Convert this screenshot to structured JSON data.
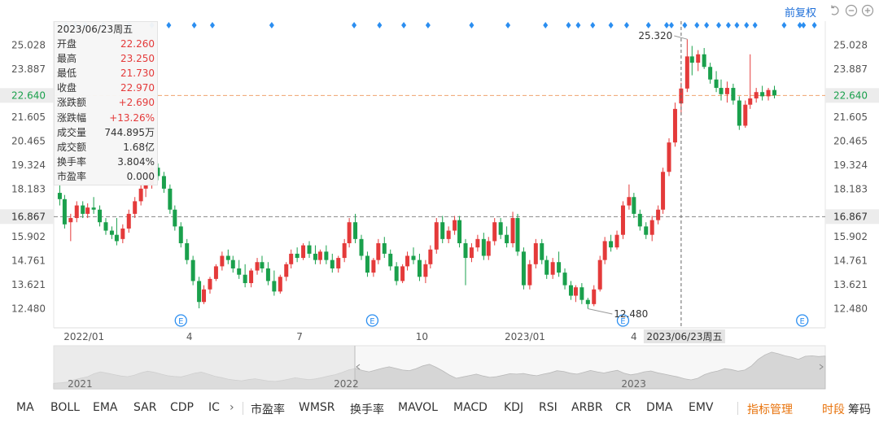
{
  "chart_data": {
    "type": "candlestick",
    "price_axis": {
      "ticks": [
        25.028,
        23.887,
        22.746,
        21.605,
        20.465,
        19.324,
        18.183,
        17.042,
        15.902,
        14.761,
        13.621,
        12.48
      ],
      "labels": [
        "25.028",
        "23.887",
        "",
        "21.605",
        "20.465",
        "19.324",
        "18.183",
        "",
        "15.902",
        "14.761",
        "13.621",
        "12.480"
      ],
      "range": [
        11.57,
        26.18
      ]
    },
    "x_labels": [
      {
        "text": "2022/01",
        "date": "2022-01-04"
      },
      {
        "text": "4",
        "date": "2022-04-01"
      },
      {
        "text": "7",
        "date": "2022-07-01"
      },
      {
        "text": "10",
        "date": "2022-10-10"
      },
      {
        "text": "2023/01",
        "date": "2023-01-03"
      },
      {
        "text": "4",
        "date": "2023-04-03"
      }
    ],
    "current_price": {
      "value": 22.64,
      "label": "22.640",
      "color": "#1aa04c"
    },
    "reference_line": {
      "value": 16.867,
      "label": "16.867"
    },
    "max_annotation": {
      "value": 25.32,
      "label": "25.320"
    },
    "min_annotation": {
      "value": 12.48,
      "label": "12.480"
    },
    "cursor_date_label": "2023/06/23周五",
    "up_color": "#e43a3a",
    "down_color": "#1aa04c",
    "ohlc": [
      [
        18.0,
        18.4,
        17.4,
        17.7
      ],
      [
        17.7,
        17.9,
        16.3,
        16.5
      ],
      [
        16.6,
        17.0,
        15.7,
        16.8
      ],
      [
        16.8,
        17.6,
        16.6,
        17.4
      ],
      [
        17.4,
        17.6,
        16.8,
        17.0
      ],
      [
        17.0,
        17.5,
        16.8,
        17.3
      ],
      [
        17.3,
        17.8,
        17.0,
        17.2
      ],
      [
        17.2,
        17.4,
        16.4,
        16.6
      ],
      [
        16.6,
        16.8,
        16.0,
        16.2
      ],
      [
        16.2,
        16.4,
        15.8,
        16.0
      ],
      [
        16.0,
        16.8,
        15.5,
        15.7
      ],
      [
        15.8,
        16.5,
        15.6,
        16.3
      ],
      [
        16.3,
        17.2,
        16.1,
        17.0
      ],
      [
        17.0,
        17.8,
        16.8,
        17.6
      ],
      [
        17.6,
        18.4,
        17.4,
        18.2
      ],
      [
        18.2,
        18.6,
        17.8,
        18.4
      ],
      [
        18.4,
        19.4,
        18.2,
        19.2
      ],
      [
        19.2,
        19.4,
        18.6,
        18.8
      ],
      [
        18.8,
        19.0,
        18.0,
        18.2
      ],
      [
        18.2,
        18.4,
        17.0,
        17.2
      ],
      [
        17.2,
        17.4,
        16.2,
        16.4
      ],
      [
        16.4,
        16.6,
        15.4,
        15.6
      ],
      [
        15.6,
        15.8,
        14.6,
        14.8
      ],
      [
        14.8,
        15.0,
        13.6,
        13.8
      ],
      [
        13.8,
        14.0,
        12.5,
        12.8
      ],
      [
        12.8,
        13.6,
        12.7,
        13.4
      ],
      [
        13.4,
        14.0,
        13.2,
        13.9
      ],
      [
        13.9,
        14.6,
        13.8,
        14.5
      ],
      [
        14.5,
        15.2,
        14.3,
        15.0
      ],
      [
        15.0,
        15.3,
        14.6,
        14.8
      ],
      [
        14.8,
        15.0,
        14.2,
        14.4
      ],
      [
        14.4,
        14.8,
        13.9,
        14.1
      ],
      [
        14.1,
        14.6,
        13.5,
        13.7
      ],
      [
        13.7,
        14.4,
        13.5,
        14.3
      ],
      [
        14.3,
        14.9,
        14.1,
        14.7
      ],
      [
        14.7,
        15.0,
        14.2,
        14.4
      ],
      [
        14.4,
        14.7,
        13.6,
        13.8
      ],
      [
        13.8,
        14.3,
        13.1,
        13.3
      ],
      [
        13.3,
        14.1,
        13.2,
        14.0
      ],
      [
        14.0,
        14.7,
        13.8,
        14.6
      ],
      [
        14.6,
        15.3,
        14.4,
        15.1
      ],
      [
        15.1,
        15.4,
        14.7,
        14.9
      ],
      [
        14.9,
        15.6,
        14.8,
        15.5
      ],
      [
        15.5,
        15.7,
        14.9,
        15.1
      ],
      [
        15.1,
        15.5,
        14.6,
        14.8
      ],
      [
        14.8,
        15.3,
        14.6,
        15.2
      ],
      [
        15.2,
        15.5,
        14.6,
        14.8
      ],
      [
        14.8,
        15.1,
        14.2,
        14.4
      ],
      [
        14.4,
        15.0,
        14.2,
        14.9
      ],
      [
        14.9,
        15.8,
        14.7,
        15.6
      ],
      [
        15.6,
        16.8,
        15.4,
        16.6
      ],
      [
        16.6,
        17.0,
        15.6,
        15.8
      ],
      [
        15.8,
        16.0,
        14.8,
        15.0
      ],
      [
        15.0,
        15.2,
        14.0,
        14.2
      ],
      [
        14.2,
        14.9,
        14.0,
        14.8
      ],
      [
        14.8,
        15.8,
        14.6,
        15.6
      ],
      [
        15.6,
        15.9,
        14.9,
        15.1
      ],
      [
        15.1,
        15.3,
        14.3,
        14.5
      ],
      [
        14.5,
        14.7,
        13.6,
        13.8
      ],
      [
        13.8,
        14.6,
        13.7,
        14.5
      ],
      [
        14.5,
        15.2,
        14.3,
        15.0
      ],
      [
        15.0,
        15.4,
        14.6,
        14.8
      ],
      [
        14.8,
        15.1,
        13.8,
        14.0
      ],
      [
        14.0,
        14.8,
        13.7,
        14.6
      ],
      [
        14.6,
        15.5,
        14.4,
        15.3
      ],
      [
        15.3,
        16.8,
        15.1,
        16.6
      ],
      [
        16.6,
        16.9,
        15.6,
        15.8
      ],
      [
        15.8,
        16.4,
        15.6,
        16.2
      ],
      [
        16.2,
        16.9,
        16.0,
        16.7
      ],
      [
        16.7,
        16.9,
        15.4,
        15.6
      ],
      [
        15.6,
        15.8,
        13.6,
        14.9
      ],
      [
        14.9,
        15.6,
        14.7,
        15.4
      ],
      [
        15.4,
        16.0,
        15.2,
        15.8
      ],
      [
        15.8,
        16.1,
        14.8,
        15.0
      ],
      [
        15.0,
        15.9,
        14.8,
        15.7
      ],
      [
        15.7,
        16.8,
        15.5,
        16.6
      ],
      [
        16.6,
        16.8,
        15.8,
        16.0
      ],
      [
        16.0,
        16.4,
        15.4,
        15.6
      ],
      [
        15.6,
        17.1,
        15.4,
        16.8
      ],
      [
        16.8,
        17.0,
        15.0,
        15.2
      ],
      [
        15.2,
        15.4,
        13.4,
        13.6
      ],
      [
        13.6,
        14.8,
        13.4,
        14.6
      ],
      [
        14.6,
        15.8,
        14.4,
        15.6
      ],
      [
        15.6,
        15.8,
        14.6,
        14.8
      ],
      [
        14.8,
        15.0,
        13.9,
        14.1
      ],
      [
        14.1,
        14.9,
        13.9,
        14.7
      ],
      [
        14.7,
        15.2,
        14.0,
        14.2
      ],
      [
        14.2,
        14.4,
        13.4,
        13.6
      ],
      [
        13.6,
        13.8,
        12.9,
        13.1
      ],
      [
        13.1,
        13.6,
        12.8,
        13.5
      ],
      [
        13.5,
        13.7,
        12.7,
        12.9
      ],
      [
        12.9,
        13.0,
        12.48,
        12.7
      ],
      [
        12.7,
        13.6,
        12.6,
        13.4
      ],
      [
        13.4,
        15.0,
        13.3,
        14.8
      ],
      [
        14.8,
        15.9,
        14.6,
        15.7
      ],
      [
        15.7,
        16.0,
        15.2,
        15.4
      ],
      [
        15.4,
        16.2,
        15.3,
        16.0
      ],
      [
        16.0,
        17.6,
        15.8,
        17.4
      ],
      [
        17.4,
        18.4,
        17.2,
        17.8
      ],
      [
        17.8,
        18.0,
        16.8,
        17.0
      ],
      [
        17.0,
        17.2,
        16.2,
        16.4
      ],
      [
        16.4,
        16.6,
        15.8,
        16.0
      ],
      [
        16.0,
        16.9,
        15.7,
        16.7
      ],
      [
        16.7,
        17.4,
        16.5,
        17.2
      ],
      [
        17.2,
        19.2,
        17.0,
        19.0
      ],
      [
        19.0,
        20.6,
        18.8,
        20.4
      ],
      [
        20.4,
        22.3,
        20.2,
        22.0
      ],
      [
        22.26,
        23.25,
        21.73,
        22.97
      ],
      [
        22.97,
        25.32,
        22.8,
        24.5
      ],
      [
        24.5,
        25.0,
        23.6,
        24.2
      ],
      [
        24.2,
        24.8,
        23.8,
        24.6
      ],
      [
        24.6,
        24.9,
        23.9,
        24.0
      ],
      [
        24.0,
        24.2,
        23.2,
        23.4
      ],
      [
        23.4,
        23.8,
        22.8,
        23.0
      ],
      [
        23.0,
        23.4,
        22.4,
        22.7
      ],
      [
        22.7,
        23.3,
        22.3,
        23.0
      ],
      [
        23.0,
        23.2,
        22.2,
        22.4
      ],
      [
        22.4,
        22.6,
        21.0,
        21.2
      ],
      [
        21.2,
        22.4,
        21.1,
        22.2
      ],
      [
        22.2,
        24.6,
        22.0,
        22.5
      ],
      [
        22.5,
        23.0,
        22.3,
        22.8
      ],
      [
        22.8,
        23.1,
        22.4,
        22.6
      ],
      [
        22.6,
        23.0,
        22.4,
        22.9
      ],
      [
        22.9,
        23.1,
        22.5,
        22.64
      ]
    ],
    "ohlc_dates": {
      "first": "2021-12-15",
      "last": "2023-07-28"
    },
    "cursor_index": 107,
    "event_markers_top": [
      {
        "x": "2021-12-20"
      },
      {
        "x": "2021-12-28"
      },
      {
        "x": "2022-01-05"
      },
      {
        "x": "2022-01-20"
      },
      {
        "x": "2022-02-10"
      },
      {
        "x": "2022-03-01"
      },
      {
        "x": "2022-03-15"
      },
      {
        "x": "2022-04-05"
      },
      {
        "x": "2022-04-20"
      },
      {
        "x": "2022-06-08"
      },
      {
        "x": "2022-08-15"
      },
      {
        "x": "2022-09-05"
      },
      {
        "x": "2022-09-25"
      },
      {
        "x": "2022-10-15"
      },
      {
        "x": "2022-11-20"
      },
      {
        "x": "2022-12-20"
      },
      {
        "x": "2023-01-20"
      },
      {
        "x": "2023-02-08"
      },
      {
        "x": "2023-02-16"
      },
      {
        "x": "2023-02-28"
      },
      {
        "x": "2023-03-15"
      },
      {
        "x": "2023-03-28"
      },
      {
        "x": "2023-04-15"
      },
      {
        "x": "2023-04-30"
      },
      {
        "x": "2023-05-04"
      },
      {
        "x": "2023-05-15"
      },
      {
        "x": "2023-05-25"
      },
      {
        "x": "2023-06-02"
      },
      {
        "x": "2023-06-12"
      },
      {
        "x": "2023-06-20"
      },
      {
        "x": "2023-06-27"
      },
      {
        "x": "2023-07-05"
      },
      {
        "x": "2023-07-12"
      },
      {
        "x": "2023-08-05"
      },
      {
        "x": "2023-08-18"
      },
      {
        "x": "2023-08-21"
      },
      {
        "x": "2023-08-30"
      }
    ],
    "event_markers_bottom": [
      {
        "x": "2022-03-25",
        "label": "E"
      },
      {
        "x": "2022-08-30",
        "label": "E"
      },
      {
        "x": "2023-03-25",
        "label": "E"
      },
      {
        "x": "2023-08-20",
        "label": "E"
      }
    ],
    "navigator": {
      "year_labels": [
        {
          "text": "2021",
          "date": "2021-02-01"
        },
        {
          "text": "2022",
          "date": "2022-01-04"
        },
        {
          "text": "2023",
          "date": "2023-01-03"
        }
      ],
      "series": [
        11.0,
        11.2,
        11.5,
        12.5,
        13.2,
        13.8,
        15.2,
        16.0,
        15.4,
        14.8,
        14.2,
        13.9,
        14.5,
        15.6,
        16.3,
        15.8,
        15.0,
        14.3,
        14.0,
        13.8,
        14.6,
        15.4,
        15.9,
        15.0,
        14.1,
        13.5,
        12.8,
        12.4,
        12.1,
        12.6,
        13.0,
        12.5,
        12.0,
        11.8,
        12.2,
        12.8,
        13.4,
        13.0,
        12.6,
        12.9,
        13.5,
        14.2,
        14.8,
        15.8,
        16.9,
        17.5,
        16.6,
        16.0,
        16.8,
        17.6,
        18.2,
        17.5,
        16.8,
        16.5,
        17.4,
        18.6,
        19.3,
        18.0,
        16.4,
        14.6,
        13.2,
        13.8,
        14.4,
        15.0,
        14.2,
        13.6,
        13.9,
        14.5,
        15.2,
        15.0,
        15.3,
        14.7,
        14.3,
        15.0,
        15.6,
        16.5,
        16.2,
        15.4,
        15.0,
        15.8,
        16.6,
        16.0,
        15.5,
        16.1,
        16.7,
        15.4,
        14.7,
        15.2,
        16.0,
        16.4,
        15.6,
        15.0,
        14.4,
        13.8,
        13.0,
        12.5,
        13.2,
        14.8,
        15.8,
        16.4,
        17.4,
        17.0,
        16.3,
        16.8,
        18.6,
        21.5,
        23.4,
        24.6,
        23.9,
        23.0,
        22.4,
        21.5,
        22.8,
        23.0,
        22.7,
        22.9
      ]
    }
  },
  "info_panel": {
    "date": "2023/06/23周五",
    "rows": [
      {
        "label": "开盘",
        "value": "22.260",
        "highlight": true
      },
      {
        "label": "最高",
        "value": "23.250",
        "highlight": true
      },
      {
        "label": "最低",
        "value": "21.730",
        "highlight": true
      },
      {
        "label": "收盘",
        "value": "22.970",
        "highlight": true
      },
      {
        "label": "涨跌额",
        "value": "+2.690",
        "highlight": true
      },
      {
        "label": "涨跌幅",
        "value": "+13.26%",
        "highlight": true
      },
      {
        "label": "成交量",
        "value": "744.895万",
        "highlight": false
      },
      {
        "label": "成交额",
        "value": "1.68亿",
        "highlight": false
      },
      {
        "label": "换手率",
        "value": "3.804%",
        "highlight": false
      },
      {
        "label": "市盈率",
        "value": "0.000",
        "highlight": false
      }
    ]
  },
  "toolbar": {
    "fuquan_label": "前复权",
    "icons": [
      "undo-icon",
      "zoom-out-icon",
      "zoom-in-icon"
    ]
  },
  "indicators": {
    "left": [
      {
        "id": "ma",
        "label": "MA"
      },
      {
        "id": "boll",
        "label": "BOLL"
      },
      {
        "id": "ema",
        "label": "EMA"
      },
      {
        "id": "sar",
        "label": "SAR"
      },
      {
        "id": "cdp",
        "label": "CDP"
      },
      {
        "id": "ic",
        "label": "IC"
      }
    ],
    "more_arrow": "›",
    "right": [
      {
        "id": "pe",
        "label": "市盈率"
      },
      {
        "id": "wmsr",
        "label": "WMSR"
      },
      {
        "id": "turnover",
        "label": "换手率"
      },
      {
        "id": "mavol",
        "label": "MAVOL"
      },
      {
        "id": "macd",
        "label": "MACD"
      },
      {
        "id": "kdj",
        "label": "KDJ"
      },
      {
        "id": "rsi",
        "label": "RSI"
      },
      {
        "id": "arbr",
        "label": "ARBR"
      },
      {
        "id": "cr",
        "label": "CR"
      },
      {
        "id": "dma",
        "label": "DMA"
      },
      {
        "id": "emv",
        "label": "EMV"
      }
    ],
    "manage_label": "指标管理",
    "time_label": "时段",
    "chips_label": "筹码"
  }
}
